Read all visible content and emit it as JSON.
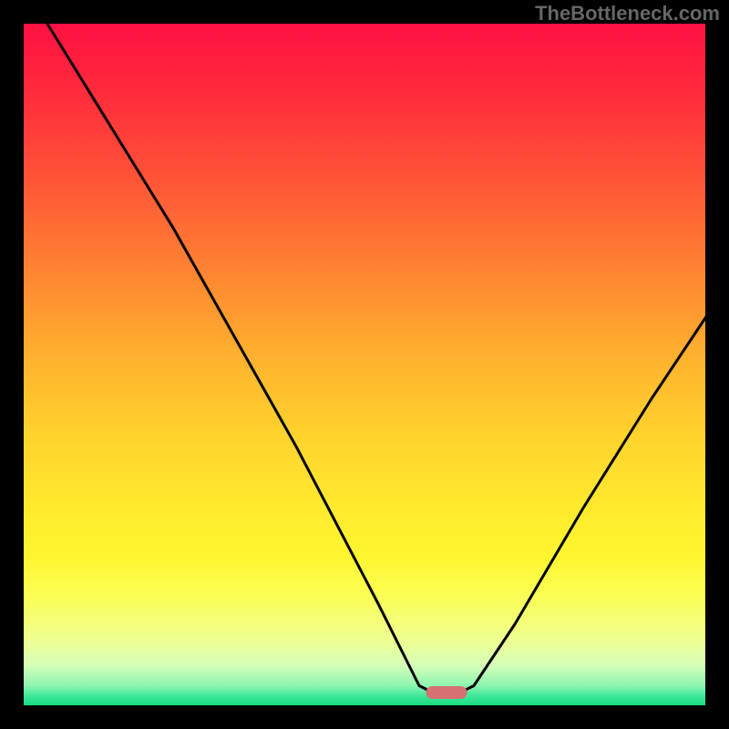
{
  "watermark": "TheBottleneck.com",
  "chart_data": {
    "type": "line",
    "title": "",
    "xlabel": "",
    "ylabel": "",
    "xlim": [
      0,
      100
    ],
    "ylim": [
      0,
      100
    ],
    "optimal_marker": {
      "x_start": 59,
      "x_end": 65,
      "y": 2
    },
    "curve_points": [
      {
        "x": 3.5,
        "y": 100
      },
      {
        "x": 22,
        "y": 70
      },
      {
        "x": 40,
        "y": 38
      },
      {
        "x": 52,
        "y": 15
      },
      {
        "x": 58,
        "y": 3
      },
      {
        "x": 60,
        "y": 2
      },
      {
        "x": 64,
        "y": 2
      },
      {
        "x": 66,
        "y": 3
      },
      {
        "x": 72,
        "y": 12
      },
      {
        "x": 82,
        "y": 29
      },
      {
        "x": 92,
        "y": 45
      },
      {
        "x": 100,
        "y": 57
      }
    ],
    "gradient_stops": [
      {
        "offset": 0.0,
        "color": "#ff1043"
      },
      {
        "offset": 0.1,
        "color": "#ff2a3c"
      },
      {
        "offset": 0.2,
        "color": "#ff4a38"
      },
      {
        "offset": 0.3,
        "color": "#ff6d34"
      },
      {
        "offset": 0.4,
        "color": "#ff9130"
      },
      {
        "offset": 0.5,
        "color": "#ffb52e"
      },
      {
        "offset": 0.6,
        "color": "#ffd22d"
      },
      {
        "offset": 0.7,
        "color": "#ffe82d"
      },
      {
        "offset": 0.78,
        "color": "#fff62f"
      },
      {
        "offset": 0.84,
        "color": "#fbfe56"
      },
      {
        "offset": 0.9,
        "color": "#f0ff8f"
      },
      {
        "offset": 0.94,
        "color": "#d6ffb8"
      },
      {
        "offset": 0.97,
        "color": "#8df5b0"
      },
      {
        "offset": 0.985,
        "color": "#3de899"
      },
      {
        "offset": 1.0,
        "color": "#13dd7f"
      }
    ],
    "marker_color": "#d77070",
    "curve_color": "#000000",
    "frame_color": "#000000",
    "inner_margin": 25,
    "inner_size": 750
  }
}
